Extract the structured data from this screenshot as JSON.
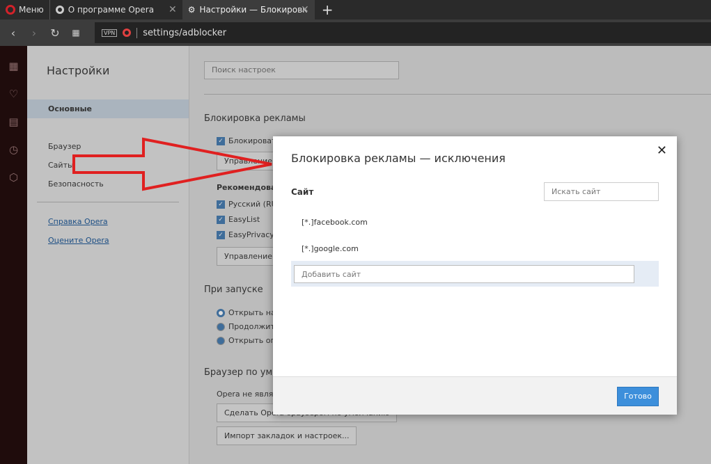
{
  "tabs": {
    "menu": "Меню",
    "tab1": "О программе Opera",
    "tab2": "Настройки — Блокировк"
  },
  "address": {
    "vpn": "VPN",
    "url": "settings/adblocker"
  },
  "settings_nav": {
    "title": "Настройки",
    "selected": "Основные",
    "items": [
      "Браузер",
      "Сайты",
      "Безопасность"
    ],
    "links": [
      "Справка Opera",
      "Оцените Opera"
    ]
  },
  "main": {
    "search_placeholder": "Поиск настроек",
    "adblock_title": "Блокировка рекламы",
    "adblock_checkbox": "Блокировать",
    "manage_exceptions": "Управление и",
    "recommended": "Рекомендован",
    "lists": [
      "Русский (RU",
      "EasyList",
      "EasyPrivacy"
    ],
    "manage_lists": "Управление с",
    "startup_title": "При запуске",
    "startup_options": [
      "Открыть на",
      "Продолжит",
      "Открыть оп"
    ],
    "default_title": "Браузер по умо",
    "default_text": "Opera не являе",
    "make_default": "Сделать Opera браузером по умолчанию",
    "import": "Импорт закладок и настроек..."
  },
  "dialog": {
    "title": "Блокировка рекламы — исключения",
    "site_label": "Сайт",
    "search_placeholder": "Искать сайт",
    "sites": [
      "[*.]facebook.com",
      "[*.]google.com"
    ],
    "add_placeholder": "Добавить сайт",
    "done": "Готово"
  },
  "colors": {
    "accent": "#3d8fdb",
    "arrow": "#e02020"
  }
}
